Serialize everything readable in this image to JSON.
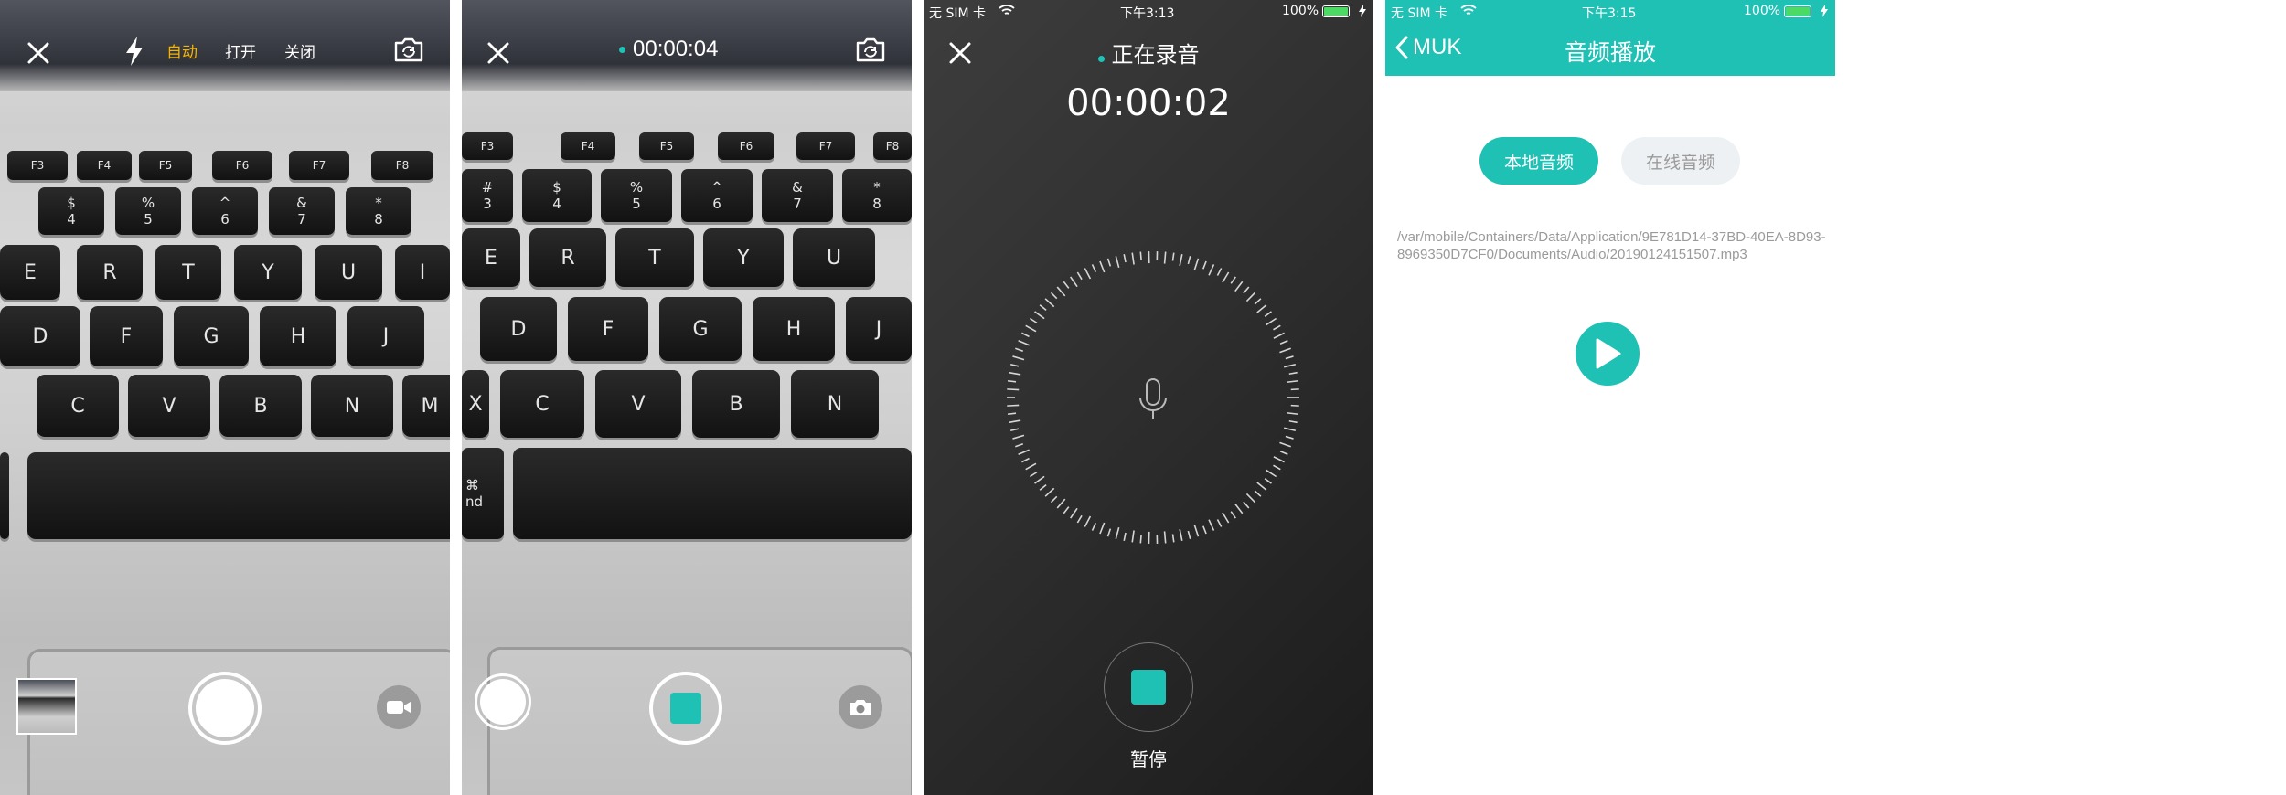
{
  "screen_camera": {
    "flash_options": [
      "自动",
      "打开",
      "关闭"
    ],
    "flash_selected": "自动",
    "keys_row_fn": [
      "F3",
      "F4",
      "F5",
      "F6",
      "F7",
      "F8"
    ],
    "keys_row_num": [
      [
        "$",
        "4"
      ],
      [
        "%",
        "5"
      ],
      [
        "^",
        "6"
      ],
      [
        "&",
        "7"
      ],
      [
        "*",
        "8"
      ]
    ],
    "keys_row_top": [
      "E",
      "R",
      "T",
      "Y",
      "U",
      "I"
    ],
    "keys_row_home": [
      "D",
      "F",
      "G",
      "H",
      "J"
    ],
    "keys_row_bottom": [
      "C",
      "V",
      "B",
      "N",
      "M"
    ]
  },
  "screen_video": {
    "timer": "00:00:04",
    "keys_row_fn": [
      "F3",
      "F4",
      "F5",
      "F6",
      "F7",
      "F8"
    ],
    "keys_row_num": [
      [
        "#",
        "3"
      ],
      [
        "$",
        "4"
      ],
      [
        "%",
        "5"
      ],
      [
        "^",
        "6"
      ],
      [
        "&",
        "7"
      ],
      [
        "*",
        "8"
      ]
    ],
    "keys_row_top": [
      "E",
      "R",
      "T",
      "Y",
      "U"
    ],
    "keys_row_home": [
      "D",
      "F",
      "G",
      "H",
      "J"
    ],
    "keys_row_bottom": [
      "X",
      "C",
      "V",
      "B",
      "N"
    ],
    "cmd_symbol": "⌘",
    "cmd_label": "nd"
  },
  "screen_recording": {
    "status": {
      "carrier": "无 SIM 卡",
      "time": "下午3:13",
      "battery": "100%"
    },
    "title": "正在录音",
    "elapsed": "00:00:02",
    "pause_label": "暂停"
  },
  "screen_playback": {
    "status": {
      "carrier": "无 SIM 卡",
      "time": "下午3:15",
      "battery": "100%"
    },
    "back_label": "MUK",
    "title": "音频播放",
    "tabs": [
      "本地音频",
      "在线音频"
    ],
    "selected_tab": "本地音频",
    "file_path": "/var/mobile/Containers/Data/Application/9E781D14-37BD-40EA-8D93-8969350D7CF0/Documents/Audio/20190124151507.mp3"
  },
  "colors": {
    "accent": "#1fc1b5",
    "flash_active": "#f5b400",
    "battery": "#4cd964"
  }
}
